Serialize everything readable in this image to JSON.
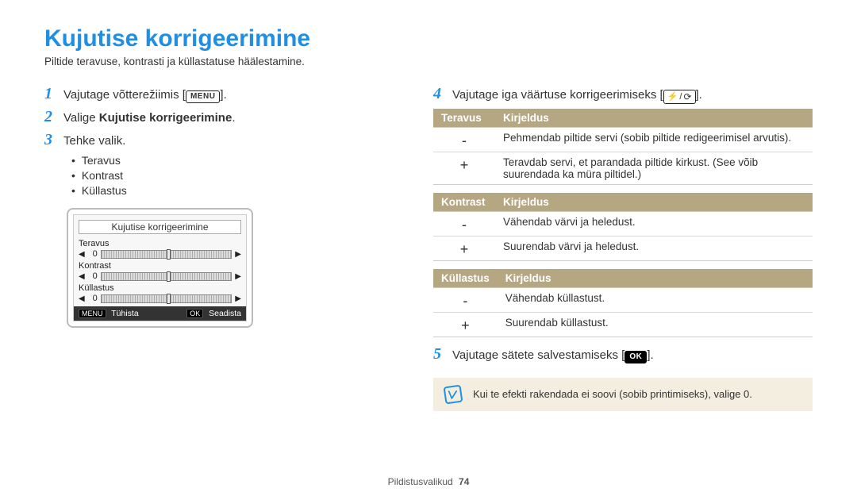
{
  "title": "Kujutise korrigeerimine",
  "subtitle": "Piltide teravuse, kontrasti ja küllastatuse häälestamine.",
  "left": {
    "step1": {
      "num": "1",
      "text_before": "Vajutage võtterežiimis [",
      "menu_key": "MENU",
      "text_after": "]."
    },
    "step2": {
      "num": "2",
      "text_before": "Valige ",
      "bold": "Kujutise korrigeerimine",
      "text_after": "."
    },
    "step3": {
      "num": "3",
      "text": "Tehke valik."
    },
    "bullets": [
      "Teravus",
      "Kontrast",
      "Küllastus"
    ],
    "device": {
      "title": "Kujutise korrigeerimine",
      "sliders": [
        {
          "label": "Teravus",
          "val": "0"
        },
        {
          "label": "Kontrast",
          "val": "0"
        },
        {
          "label": "Küllastus",
          "val": "0"
        }
      ],
      "cancel_btn": "MENU",
      "cancel_label": "Tühista",
      "ok_btn": "OK",
      "ok_label": "Seadista"
    }
  },
  "right": {
    "step4": {
      "num": "4",
      "text_before": "Vajutage iga väärtuse korrigeerimiseks [",
      "text_after": "]."
    },
    "tables": [
      {
        "head1": "Teravus",
        "head2": "Kirjeldus",
        "rows": [
          {
            "sym": "-",
            "desc": "Pehmendab piltide servi (sobib piltide redigeerimisel arvutis)."
          },
          {
            "sym": "+",
            "desc": "Teravdab servi, et parandada piltide kirkust. (See võib suurendada ka müra piltidel.)"
          }
        ]
      },
      {
        "head1": "Kontrast",
        "head2": "Kirjeldus",
        "rows": [
          {
            "sym": "-",
            "desc": "Vähendab värvi ja heledust."
          },
          {
            "sym": "+",
            "desc": "Suurendab värvi ja heledust."
          }
        ]
      },
      {
        "head1": "Küllastus",
        "head2": "Kirjeldus",
        "rows": [
          {
            "sym": "-",
            "desc": "Vähendab küllastust."
          },
          {
            "sym": "+",
            "desc": "Suurendab küllastust."
          }
        ]
      }
    ],
    "step5": {
      "num": "5",
      "text_before": "Vajutage sätete salvestamiseks [",
      "ok_key": "OK",
      "text_after": "]."
    },
    "note": "Kui te efekti rakendada ei soovi (sobib printimiseks), valige 0."
  },
  "footer": {
    "section": "Pildistusvalikud",
    "page": "74"
  }
}
